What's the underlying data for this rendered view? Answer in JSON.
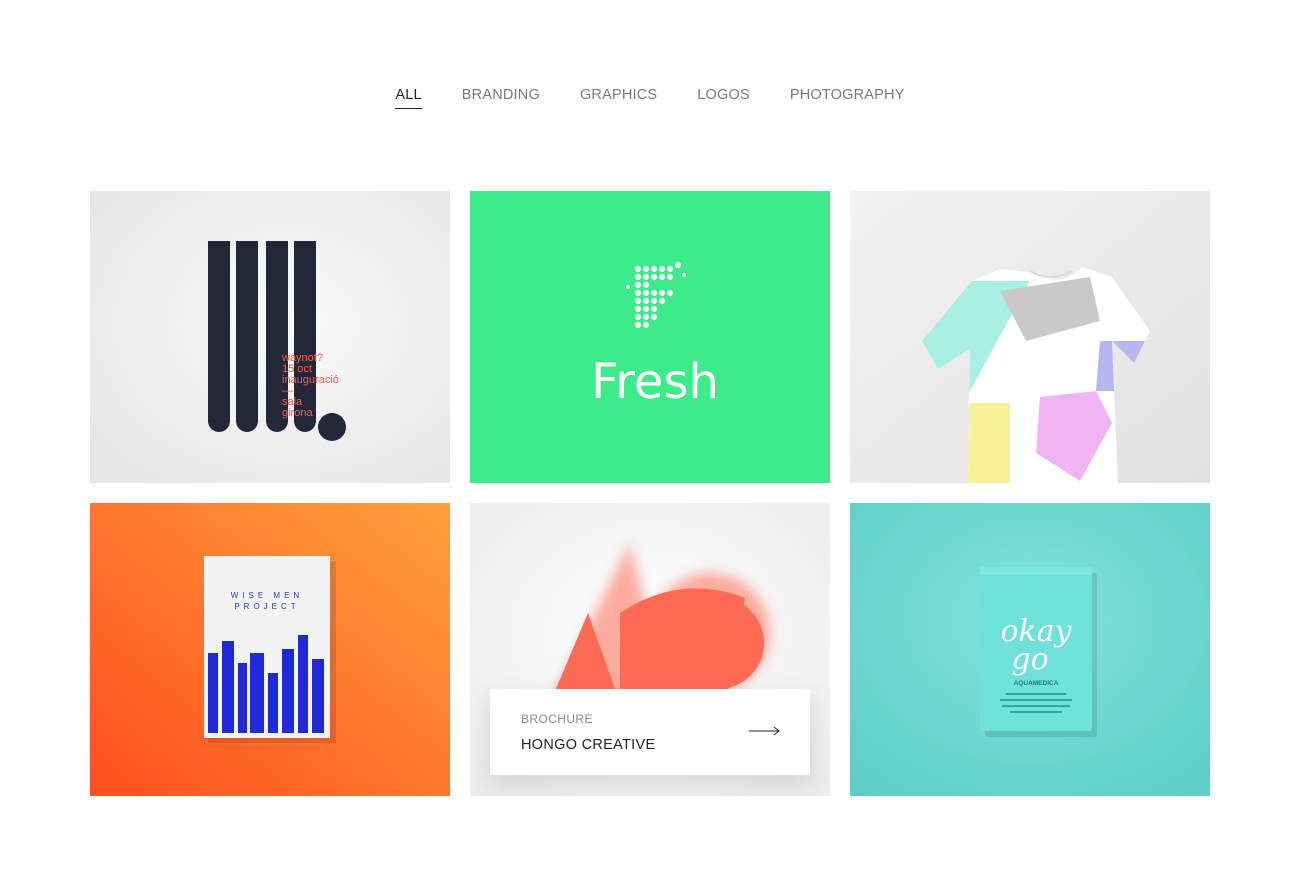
{
  "filters": [
    {
      "label": "ALL",
      "active": true
    },
    {
      "label": "BRANDING",
      "active": false
    },
    {
      "label": "GRAPHICS",
      "active": false
    },
    {
      "label": "LOGOS",
      "active": false
    },
    {
      "label": "PHOTOGRAPHY",
      "active": false
    }
  ],
  "tiles": {
    "poster": {
      "lines": [
        "waynot?",
        "15 oct",
        "inauguració",
        "—",
        "sala",
        "girona"
      ]
    },
    "fresh": {
      "brand": "Fresh",
      "bg": "#3deb8b"
    },
    "book": {
      "title_line1": "WISE MEN",
      "title_line2": "PROJECT"
    },
    "brochure": {
      "category": "BROCHURE",
      "title": "HONGO CREATIVE",
      "arrow_icon": "long-arrow-right-icon"
    },
    "box": {
      "logo_line1": "okay",
      "logo_line2": "go",
      "brand": "AQUAMEDICA"
    }
  },
  "colors": {
    "active_filter": "#232323",
    "inactive_filter": "#7a7a7a",
    "accent_red": "#ff6a55",
    "mint": "#6ddbd3"
  }
}
